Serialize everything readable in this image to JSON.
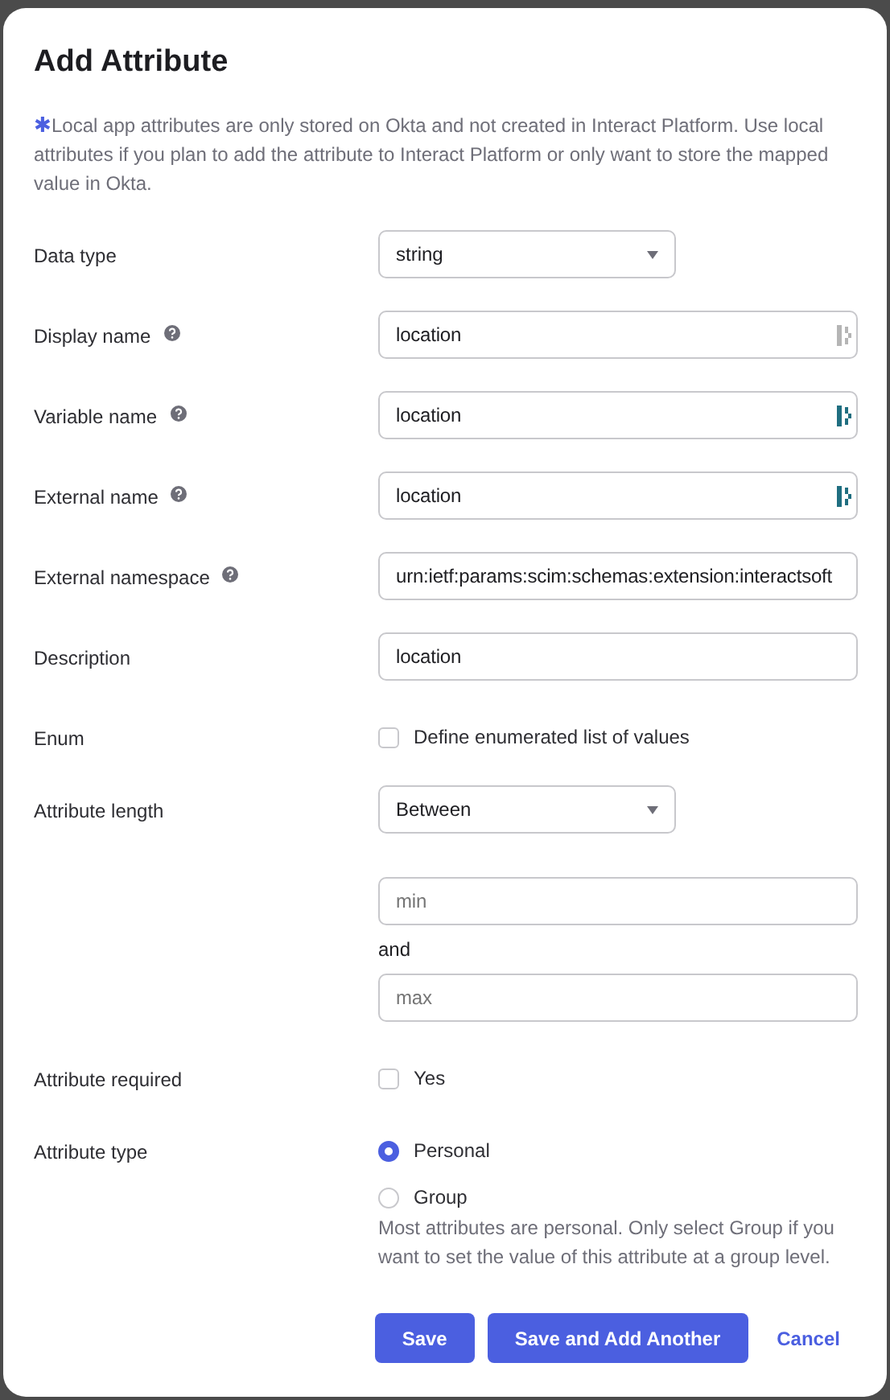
{
  "dialog": {
    "title": "Add Attribute",
    "note_mark": "✱",
    "note": "Local app attributes are only stored on Okta and not created in Interact Platform. Use local attributes if you plan to add the attribute to Interact Platform or only want to store the mapped value in Okta.",
    "fields": [
      {
        "kind": "select",
        "label": "Data type",
        "value": "string"
      },
      {
        "kind": "text",
        "label": "Display name",
        "help": true,
        "value": "location",
        "mapping_active": false
      },
      {
        "kind": "text",
        "label": "Variable name",
        "help": true,
        "value": "location",
        "mapping_active": true
      },
      {
        "kind": "text",
        "label": "External name",
        "help": true,
        "value": "location",
        "mapping_active": true
      },
      {
        "kind": "text",
        "label": "External namespace",
        "help": true,
        "value": "urn:ietf:params:scim:schemas:extension:interactsoft"
      },
      {
        "kind": "text",
        "label": "Description",
        "value": "location"
      },
      {
        "kind": "checkbox",
        "label": "Enum",
        "option": "Define enumerated list of values",
        "checked": false
      },
      {
        "kind": "range",
        "label": "Attribute length",
        "value": "Between",
        "min_placeholder": "min",
        "joiner": "and",
        "max_placeholder": "max"
      },
      {
        "kind": "checkbox",
        "label": "Attribute required",
        "option": "Yes",
        "checked": false
      },
      {
        "kind": "radio",
        "label": "Attribute type",
        "options": [
          {
            "label": "Personal",
            "selected": true
          },
          {
            "label": "Group",
            "selected": false
          }
        ],
        "hint": "Most attributes are personal. Only select Group if you want to set the value of this attribute at a group level."
      }
    ],
    "buttons": [
      {
        "label": "Save",
        "kind": "primary"
      },
      {
        "label": "Save and Add Another",
        "kind": "primary"
      },
      {
        "label": "Cancel",
        "kind": "link"
      }
    ]
  }
}
